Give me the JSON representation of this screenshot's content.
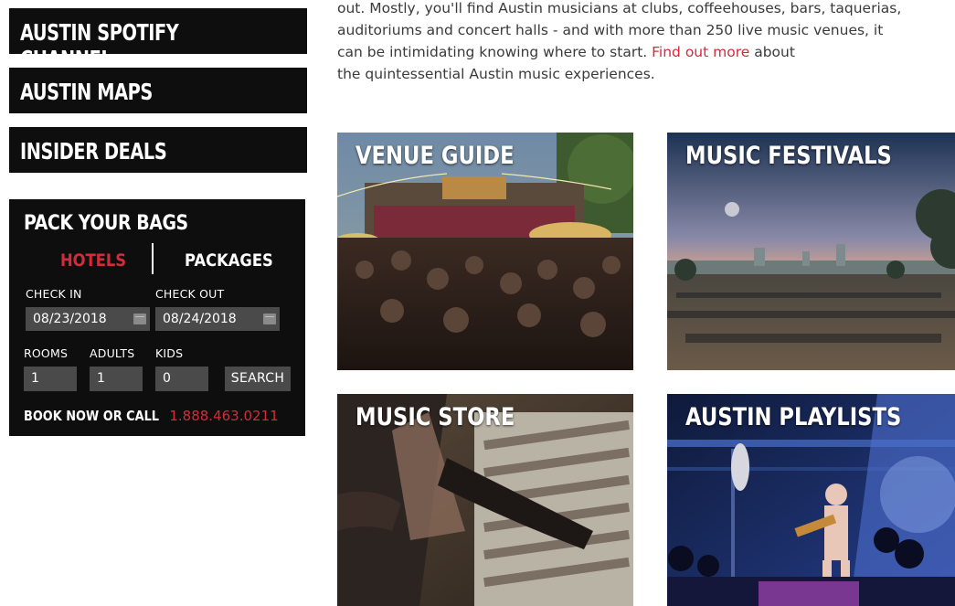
{
  "nav": {
    "items": [
      {
        "label": "AUSTIN SPOTIFY CHANNEL"
      },
      {
        "label": "AUSTIN MAPS"
      },
      {
        "label": "INSIDER DEALS"
      }
    ]
  },
  "booking": {
    "title": "PACK YOUR BAGS",
    "tabs": {
      "hotels": "HOTELS",
      "packages": "PACKAGES"
    },
    "check_in_label": "CHECK IN",
    "check_out_label": "CHECK OUT",
    "check_in_value": "08/23/2018",
    "check_out_value": "08/24/2018",
    "rooms_label": "ROOMS",
    "adults_label": "ADULTS",
    "kids_label": "KIDS",
    "rooms_value": "1",
    "adults_value": "1",
    "kids_value": "0",
    "search_label": "SEARCH",
    "book_label": "BOOK NOW OR CALL",
    "phone": "1.888.463.0211",
    "accent_color": "#d42b3a"
  },
  "intro": {
    "line1": "out. Mostly, you'll find Austin musicians at clubs, coffeehouses, bars, taquerias,",
    "line2": "auditoriums and concert halls - and with more than 250 live music venues, it",
    "line3_pre": "can be intimidating knowing where to start. ",
    "link": "Find out more",
    "line3_post": " about",
    "line4": "the quintessential Austin music experiences."
  },
  "tiles": {
    "venue": "VENUE GUIDE",
    "festivals": "MUSIC FESTIVALS",
    "store": "MUSIC STORE",
    "playlists": "AUSTIN PLAYLISTS"
  }
}
